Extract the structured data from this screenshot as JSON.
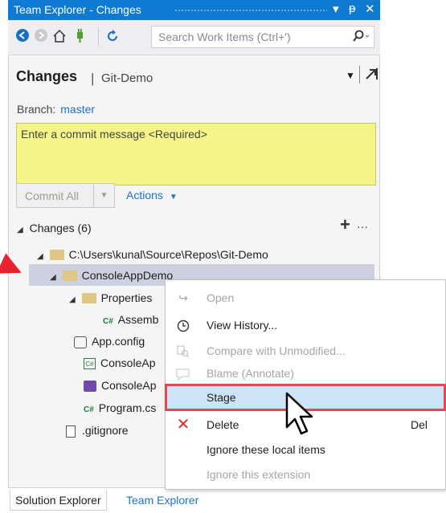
{
  "window": {
    "title": "Team Explorer - Changes",
    "controls": [
      "▾",
      "ᵽ",
      "✕"
    ]
  },
  "toolbar": {
    "search_placeholder": "Search Work Items (Ctrl+')"
  },
  "header": {
    "title": "Changes",
    "separator": "|",
    "repo": "Git-Demo"
  },
  "branch": {
    "label": "Branch:",
    "value": "master"
  },
  "commit": {
    "placeholder": "Enter a commit message <Required>",
    "commit_all": "Commit All",
    "actions": "Actions"
  },
  "changes": {
    "label": "Changes (6)",
    "tree": {
      "repo_path": "C:\\Users\\kunal\\Source\\Repos\\Git-Demo",
      "project": "ConsoleAppDemo",
      "properties": "Properties",
      "assembly": "Assemb",
      "app_config": "App.config",
      "console_file_1": "ConsoleAp",
      "console_file_2": "ConsoleAp",
      "program": "Program.cs",
      "gitignore": ".gitignore"
    }
  },
  "context_menu": {
    "items": [
      {
        "label": "Open",
        "enabled": false,
        "icon": "open-icon"
      },
      {
        "label": "View History...",
        "enabled": true,
        "icon": "history-icon"
      },
      {
        "label": "Compare with Unmodified...",
        "enabled": false,
        "icon": "compare-icon"
      },
      {
        "label": "Blame (Annotate)",
        "enabled": false,
        "icon": "blame-icon"
      },
      {
        "label": "Stage",
        "enabled": true,
        "highlighted": true
      },
      {
        "label": "Delete",
        "enabled": true,
        "shortcut": "Del",
        "icon": "delete-icon"
      },
      {
        "label": "Ignore these local items",
        "enabled": true
      },
      {
        "label": "Ignore this extension",
        "enabled": false
      }
    ]
  },
  "bottom_tabs": [
    "Solution Explorer",
    "Team Explorer"
  ],
  "colors": {
    "title_bar": "#0e7ad1",
    "link": "#1e73c8",
    "commit_box": "#f5f58a",
    "highlight_border": "#e8454f",
    "arrow": "#e8232e"
  }
}
